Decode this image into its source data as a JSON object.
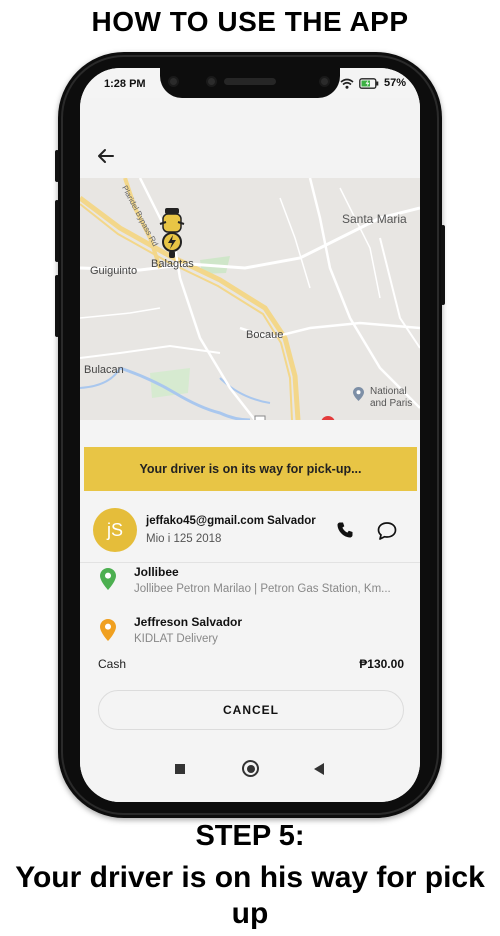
{
  "page": {
    "title": "HOW TO USE THE APP",
    "step_title": "STEP 5:",
    "step_description": "Your driver is on his way for pick up"
  },
  "status_bar": {
    "time": "1:28 PM",
    "battery": "57%",
    "icons": [
      "wifi-icon",
      "battery-icon"
    ]
  },
  "map": {
    "labels": {
      "santa_maria": "Santa Maria",
      "balagtas": "Balagtas",
      "guiguinto": "Guiguinto",
      "bocaue": "Bocaue",
      "bulacan": "Bulacan",
      "road": "Plaridel Bypass Rd",
      "poi_line1": "National",
      "poi_line2": "and Paris"
    },
    "driver_marker_icon": "motorcycle-driver-icon"
  },
  "status_banner": "Your driver is on its way for pick-up...",
  "driver": {
    "avatar_initials": "jS",
    "name": "jeffako45@gmail.com Salvador",
    "vehicle": "Mio i 125 2018"
  },
  "pickup": {
    "title": "Jollibee",
    "address": "Jollibee Petron Marilao | Petron Gas Station, Km..."
  },
  "dropoff": {
    "title": "Jeffreson Salvador",
    "subtitle": "KIDLAT Delivery"
  },
  "payment": {
    "method": "Cash",
    "amount": "₱130.00"
  },
  "cancel_label": "CANCEL",
  "colors": {
    "banner": "#e8c545",
    "avatar": "#e5bd3a",
    "pickup_pin": "#4caf50",
    "dropoff_pin": "#f0a020"
  }
}
